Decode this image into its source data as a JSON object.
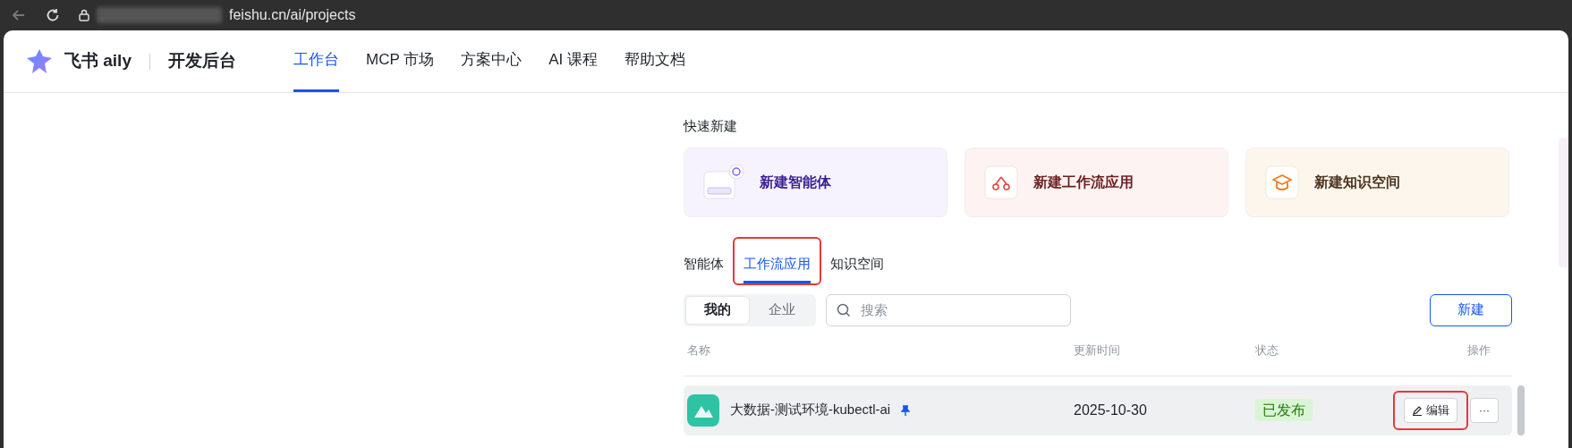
{
  "browser": {
    "url": "feishu.cn/ai/projects"
  },
  "header": {
    "brand": "飞书 aily",
    "product": "开发后台",
    "nav": [
      {
        "label": "工作台",
        "selected": true
      },
      {
        "label": "MCP 市场",
        "selected": false
      },
      {
        "label": "方案中心",
        "selected": false
      },
      {
        "label": "AI 课程",
        "selected": false
      },
      {
        "label": "帮助文档",
        "selected": false
      }
    ]
  },
  "quick_create": {
    "title": "快速新建",
    "cards": [
      {
        "kind": "agent",
        "label": "新建智能体",
        "color": "#3b1f8f"
      },
      {
        "kind": "workflow",
        "label": "新建工作流应用",
        "color": "#6b1f1f"
      },
      {
        "kind": "knowledge",
        "label": "新建知识空间",
        "color": "#4a3320"
      }
    ]
  },
  "tabs": [
    {
      "label": "智能体",
      "selected": false,
      "highlighted": false
    },
    {
      "label": "工作流应用",
      "selected": true,
      "highlighted": true
    },
    {
      "label": "知识空间",
      "selected": false,
      "highlighted": false
    }
  ],
  "scope": [
    {
      "label": "我的",
      "selected": true
    },
    {
      "label": "企业",
      "selected": false
    }
  ],
  "search": {
    "placeholder": "搜索"
  },
  "new_button": "新建",
  "table": {
    "columns": [
      "名称",
      "更新时间",
      "状态",
      "操作"
    ],
    "rows": [
      {
        "name": "大数据-测试环境-kubectl-ai",
        "pinned": true,
        "updated": "2025-10-30",
        "status": "已发布",
        "edit": "编辑",
        "more": "···",
        "edit_highlighted": true
      }
    ]
  },
  "right_panel": {
    "kind": "panel"
  }
}
